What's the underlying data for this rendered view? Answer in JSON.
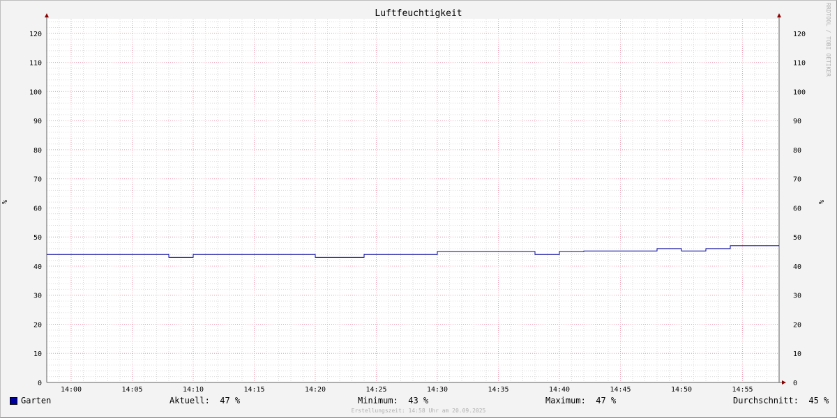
{
  "chart_data": {
    "type": "line",
    "title": "Luftfeuchtigkeit",
    "ylabel": "%",
    "ylim": [
      0,
      125
    ],
    "y_ticks": [
      0,
      10,
      20,
      30,
      40,
      50,
      60,
      70,
      80,
      90,
      100,
      110,
      120
    ],
    "x_range": [
      "13:58",
      "14:58"
    ],
    "x_ticks": [
      "14:00",
      "14:05",
      "14:10",
      "14:15",
      "14:20",
      "14:25",
      "14:30",
      "14:35",
      "14:40",
      "14:45",
      "14:50",
      "14:55"
    ],
    "grid": true,
    "series": [
      {
        "name": "Garten",
        "color": "#00009c",
        "step": true,
        "points": [
          [
            "13:58",
            44
          ],
          [
            "14:08",
            43
          ],
          [
            "14:10",
            44
          ],
          [
            "14:20",
            43
          ],
          [
            "14:24",
            44
          ],
          [
            "14:30",
            45
          ],
          [
            "14:38",
            44
          ],
          [
            "14:40",
            45
          ],
          [
            "14:42",
            45.2
          ],
          [
            "14:48",
            46
          ],
          [
            "14:50",
            45.2
          ],
          [
            "14:52",
            46
          ],
          [
            "14:54",
            47
          ],
          [
            "14:58",
            47
          ]
        ]
      }
    ]
  },
  "legend": {
    "series_name": "Garten",
    "current_label": "Aktuell:",
    "current_value": "47 %",
    "min_label": "Minimum:",
    "min_value": "43 %",
    "max_label": "Maximum:",
    "max_value": "47 %",
    "avg_label": "Durchschnitt:",
    "avg_value": "45 %"
  },
  "footer": "Erstellungszeit: 14:58 Uhr am 20.09.2025",
  "watermark": "RRDTOOL / TOBI OETIKER"
}
